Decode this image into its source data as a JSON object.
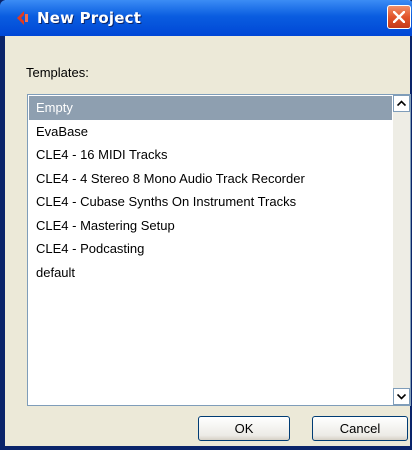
{
  "window": {
    "title": "New Project",
    "templates_label": "Templates:"
  },
  "templates": [
    {
      "label": "Empty",
      "selected": true
    },
    {
      "label": "EvaBase",
      "selected": false
    },
    {
      "label": "CLE4 - 16 MIDI Tracks",
      "selected": false
    },
    {
      "label": "CLE4 - 4 Stereo 8 Mono Audio Track Recorder",
      "selected": false
    },
    {
      "label": "CLE4 - Cubase Synths On Instrument Tracks",
      "selected": false
    },
    {
      "label": "CLE4 - Mastering Setup",
      "selected": false
    },
    {
      "label": "CLE4 - Podcasting",
      "selected": false
    },
    {
      "label": "default",
      "selected": false
    }
  ],
  "buttons": {
    "ok": "OK",
    "cancel": "Cancel"
  },
  "icons": {
    "app": "cubase-logo-icon",
    "close": "close-icon",
    "scroll_up": "scroll-up-arrow-icon",
    "scroll_down": "scroll-down-arrow-icon"
  },
  "colors": {
    "titlebar": "#0a5de0",
    "selection": "#8e9fb0",
    "close": "#e2542a"
  }
}
